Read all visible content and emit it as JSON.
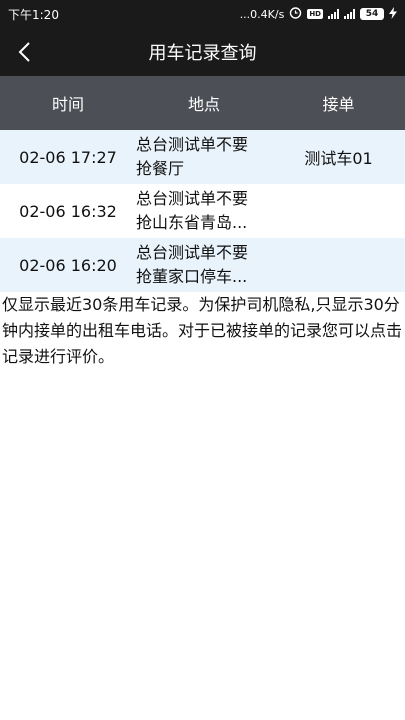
{
  "status": {
    "time": "下午1:20",
    "net_speed": "...0.4K/s",
    "battery": "54"
  },
  "nav": {
    "title": "用车记录查询"
  },
  "table": {
    "headers": {
      "time": "时间",
      "place": "地点",
      "driver": "接单"
    },
    "rows": [
      {
        "time": "02-06 17:27",
        "place_line1": "总台测试单不要",
        "place_line2": "抢餐厅",
        "driver": "测试车01"
      },
      {
        "time": "02-06 16:32",
        "place_line1": "总台测试单不要",
        "place_line2": "抢山东省青岛...",
        "driver": ""
      },
      {
        "time": "02-06 16:20",
        "place_line1": "总台测试单不要",
        "place_line2": "抢董家口停车...",
        "driver": ""
      }
    ]
  },
  "notice": "仅显示最近30条用车记录。为保护司机隐私,只显示30分钟内接单的出租车电话。对于已被接单的记录您可以点击记录进行评价。"
}
